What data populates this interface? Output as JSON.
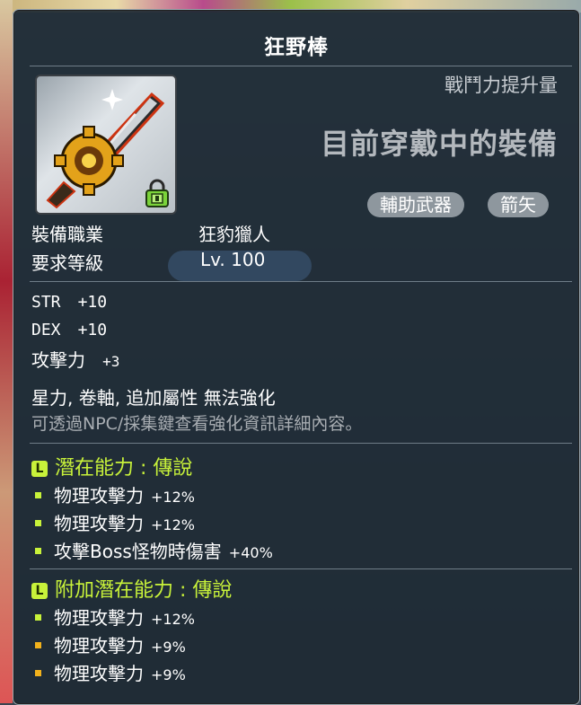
{
  "title": "狂野棒",
  "combat_power_label": "戰鬥力提升量",
  "equipped_text": "目前穿戴中的裝備",
  "badges": [
    "輔助武器",
    "箭矢"
  ],
  "job": {
    "label": "裝備職業",
    "value": "狂豹獵人"
  },
  "level": {
    "label": "要求等級",
    "value": "Lv. 100"
  },
  "stats": [
    {
      "name": "STR",
      "value": "+10"
    },
    {
      "name": "DEX",
      "value": "+10"
    },
    {
      "name": "攻擊力",
      "value": "+3"
    }
  ],
  "enhance_note": "星力, 卷軸, 追加屬性 無法強化",
  "npc_note": "可透過NPC/採集鍵查看強化資訊詳細內容。",
  "potential": {
    "title": "潛在能力 : 傳說",
    "lines": [
      {
        "text": "物理攻擊力",
        "value": "+12%",
        "color": "#c8f23a"
      },
      {
        "text": "物理攻擊力",
        "value": "+12%",
        "color": "#c8f23a"
      },
      {
        "text": "攻擊Boss怪物時傷害",
        "value": "+40%",
        "color": "#c8f23a"
      }
    ]
  },
  "additional_potential": {
    "title": "附加潛在能力 : 傳說",
    "lines": [
      {
        "text": "物理攻擊力",
        "value": "+12%",
        "color": "#c8f23a"
      },
      {
        "text": "物理攻擊力",
        "value": "+9%",
        "color": "#f2b21c"
      },
      {
        "text": "物理攻擊力",
        "value": "+9%",
        "color": "#f2b21c"
      }
    ]
  },
  "icons": {
    "item": "wild-bow-icon",
    "lock": "lock-icon"
  },
  "colors": {
    "legendary": "#c8f23a",
    "unique": "#f2b21c"
  }
}
